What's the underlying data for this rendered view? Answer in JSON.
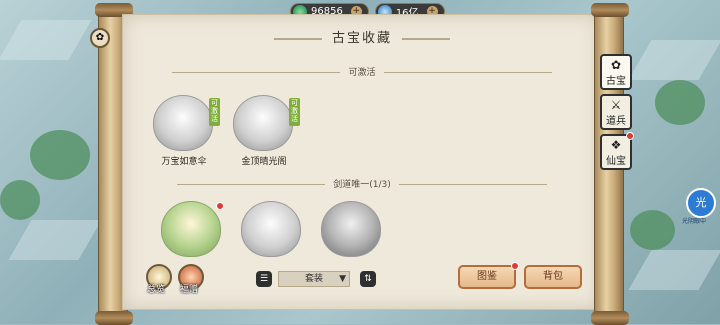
{
  "topbar": {
    "coin_value": "96856",
    "gem_value": "16亿",
    "coin_icon": "jade-coin-icon",
    "gem_icon": "spirit-gem-icon",
    "plus_symbol": "+"
  },
  "panel": {
    "title": "古宝收藏",
    "section_activatable": {
      "label": "可激活",
      "items": [
        {
          "name": "万宝如意伞",
          "tag": "可激活"
        },
        {
          "name": "金顶晴光阁",
          "tag": "可激活"
        }
      ]
    },
    "section_sword": {
      "label": "剑道唯一(1/3)",
      "item_icons": [
        "jade-sword-treasure-icon",
        "silver-sword-treasure-icon",
        "dark-sword-treasure-icon"
      ]
    }
  },
  "bottom": {
    "overview_label": "总览",
    "welfare_label": "福赠",
    "filter_value": "套装",
    "filter_arrow": "▼",
    "list_icon": "☰",
    "sort_icon": "⇅",
    "atlas_button": "图鉴",
    "bag_button": "背包"
  },
  "side_tabs": [
    {
      "label": "古宝",
      "glyph": "✿"
    },
    {
      "label": "道兵",
      "glyph": "⚔"
    },
    {
      "label": "仙宝",
      "glyph": "❖"
    }
  ],
  "right_badge": {
    "glyph": "光",
    "label": "光阴眼中"
  },
  "left_button_glyph": "✿",
  "colors": {
    "accent_red": "#e03a2e",
    "tag_green": "#7fae3a",
    "button_border": "#b56c3a"
  }
}
